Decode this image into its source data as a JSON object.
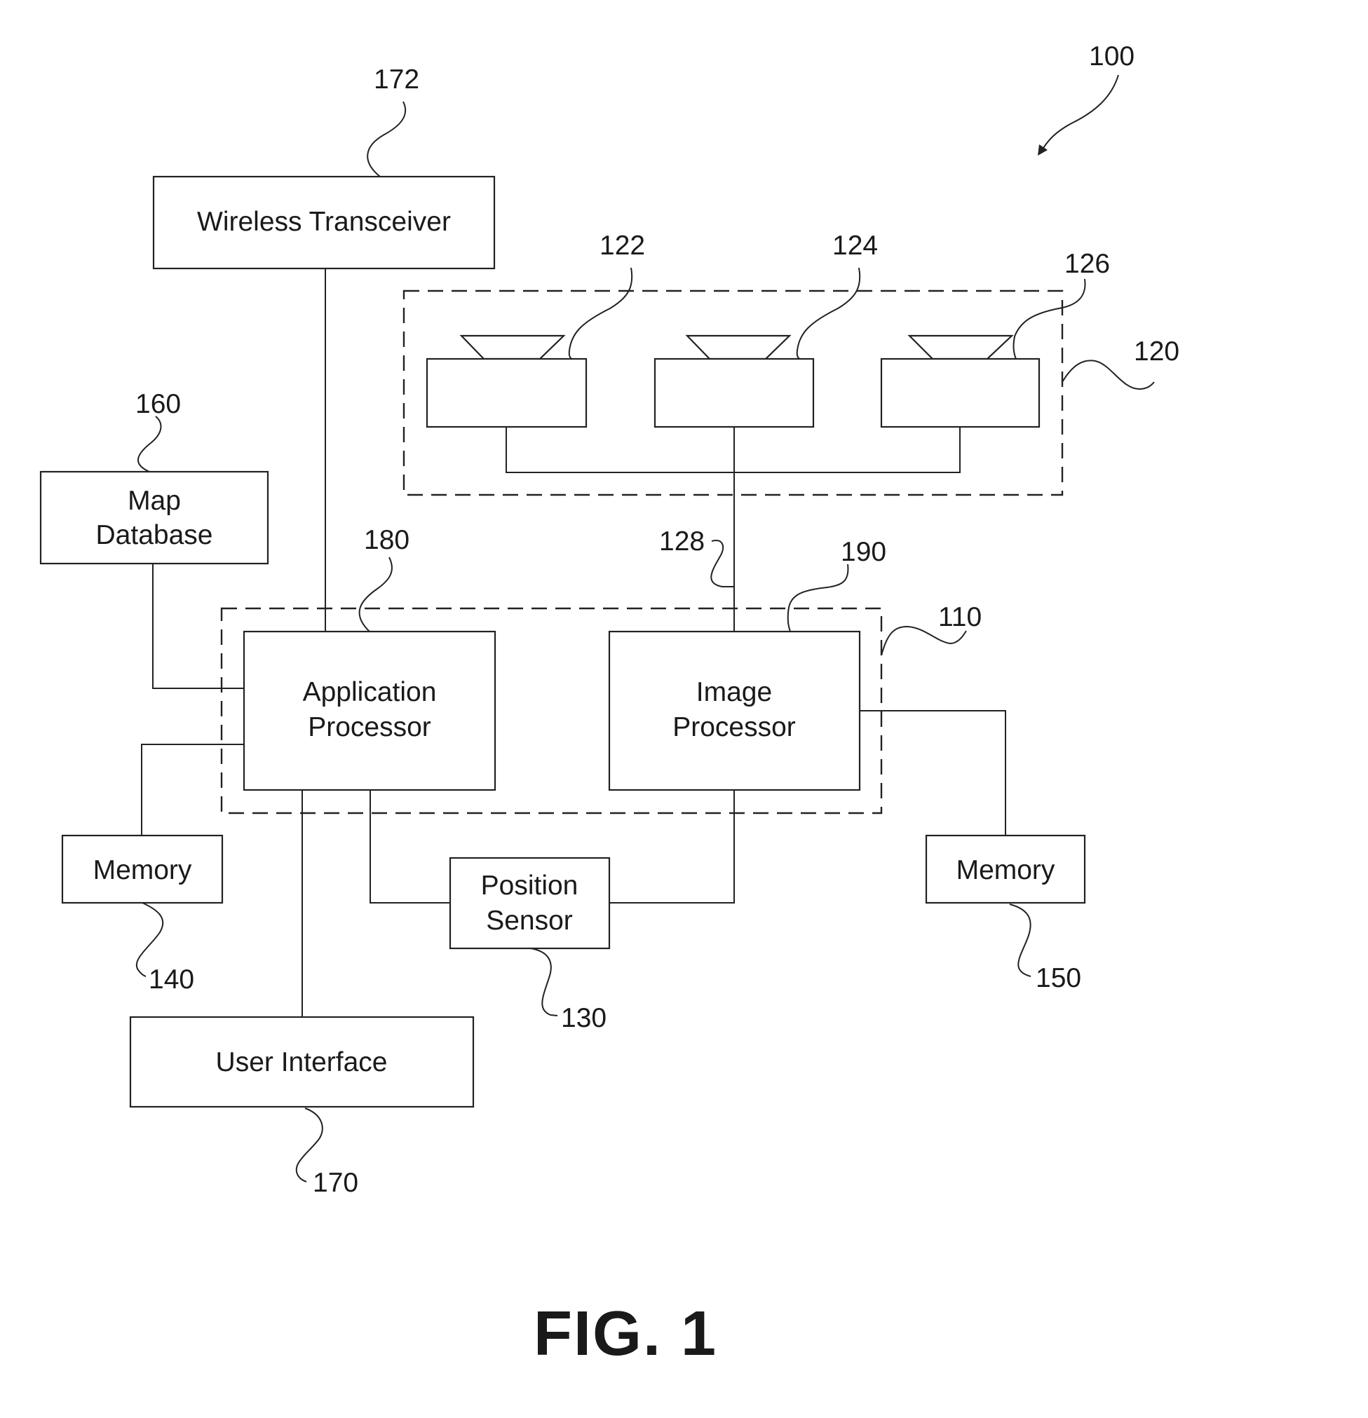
{
  "figure": {
    "caption": "FIG. 1",
    "system_ref": "100"
  },
  "blocks": {
    "wireless_transceiver": {
      "label": "Wireless Transceiver",
      "ref": "172"
    },
    "map_database": {
      "label_line1": "Map",
      "label_line2": "Database",
      "ref": "160"
    },
    "application_processor": {
      "label_line1": "Application",
      "label_line2": "Processor",
      "ref": "180"
    },
    "image_processor": {
      "label_line1": "Image",
      "label_line2": "Processor",
      "ref": "190"
    },
    "memory_left": {
      "label": "Memory",
      "ref": "140"
    },
    "memory_right": {
      "label": "Memory",
      "ref": "150"
    },
    "position_sensor": {
      "label_line1": "Position",
      "label_line2": "Sensor",
      "ref": "130"
    },
    "user_interface": {
      "label": "User Interface",
      "ref": "170"
    }
  },
  "groups": {
    "image_capture_unit": {
      "ref": "120"
    },
    "processing_unit": {
      "ref": "110"
    }
  },
  "cameras": [
    {
      "ref": "122"
    },
    {
      "ref": "124"
    },
    {
      "ref": "126"
    }
  ],
  "connections": {
    "camera_bus_ref": "128"
  }
}
